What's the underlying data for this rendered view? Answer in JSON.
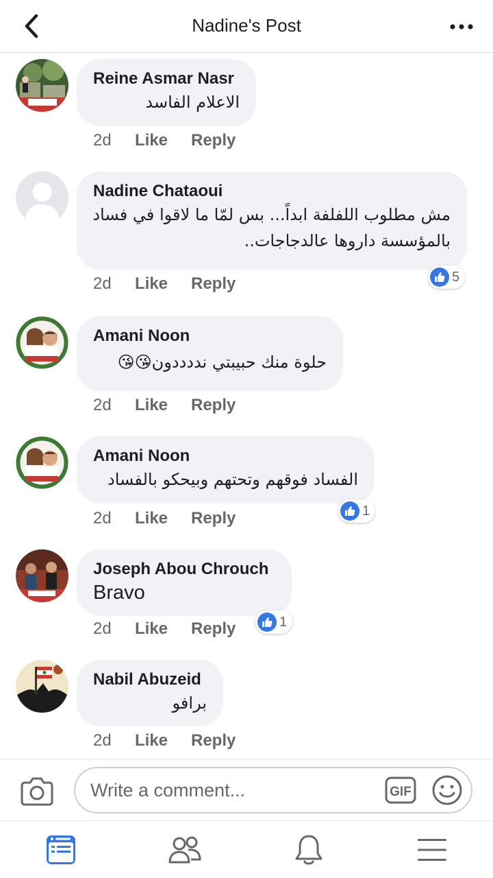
{
  "header": {
    "title": "Nadine's Post"
  },
  "comments": [
    {
      "author": "Reine Asmar Nasr",
      "text": "الاعلام الفاسد",
      "time": "2d",
      "like": "Like",
      "reply": "Reply"
    },
    {
      "author": "Nadine Chataoui",
      "text_line1": "مش مطلوب اللفلفة ابداً... بس لمّا ما لاقوا في فساد",
      "text_line2": "بالمؤسسة داروها عالدجاجات..",
      "time": "2d",
      "like": "Like",
      "reply": "Reply",
      "reactions": "5"
    },
    {
      "author": "Amani Noon",
      "text": "حلوة منك حبيبتي نددددون😘😘",
      "time": "2d",
      "like": "Like",
      "reply": "Reply"
    },
    {
      "author": "Amani Noon",
      "text": "الفساد فوقهم وتحتهم وبيحكو بالفساد",
      "time": "2d",
      "like": "Like",
      "reply": "Reply",
      "reactions": "1"
    },
    {
      "author": "Joseph Abou Chrouch",
      "text": "Bravo",
      "time": "2d",
      "like": "Like",
      "reply": "Reply",
      "reactions": "1"
    },
    {
      "author": "Nabil Abuzeid",
      "text": "برافو",
      "time": "2d",
      "like": "Like",
      "reply": "Reply"
    }
  ],
  "composer": {
    "placeholder": "Write a comment..."
  },
  "colors": {
    "accent": "#3578e5",
    "bubble": "#f0f2f5",
    "muted": "#65676b"
  },
  "icons": {
    "back": "chevron-left-icon",
    "more": "more-dots-icon",
    "camera": "camera-icon",
    "gif": "gif-icon",
    "emoji": "smiley-icon",
    "like": "thumbs-up-icon",
    "tabs": [
      "news-feed-icon",
      "friends-icon",
      "notifications-bell-icon",
      "menu-icon"
    ]
  }
}
